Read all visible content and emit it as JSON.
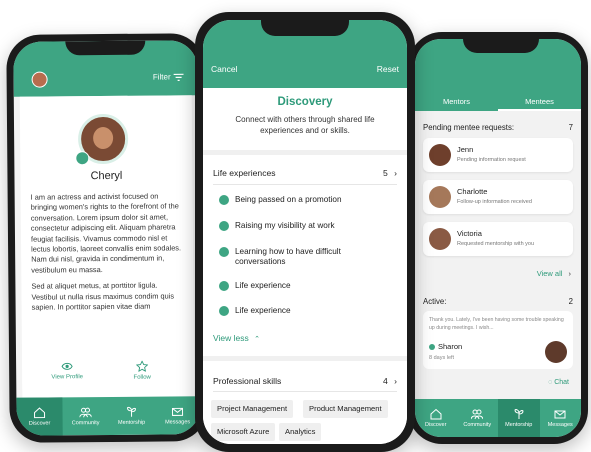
{
  "left_phone": {
    "filter_label": "Filter",
    "profile_name": "Cheryl",
    "bio_p1": "I am an actress and activist focused on bringing women's rights to the forefront of the conversation. Lorem ipsum dolor sit amet, consectetur adipiscing elit. Aliquam pharetra feugiat facilisis. Vivamus commodo nisl et lectus lobortis, laoreet convallis enim sodales. Nam dui nisl, gravida in condimentum in, vestibulum eu massa.",
    "bio_p2": "Sed at aliquet metus, at porttitor ligula. Vestibul ut nulla risus maximus condim quis sapien. In porttitor sapien vitae diam",
    "view_profile_label": "View Profile",
    "follow_label": "Follow",
    "tabs": [
      "Discover",
      "Community",
      "Mentorship",
      "Messages"
    ]
  },
  "center_phone": {
    "cancel_label": "Cancel",
    "reset_label": "Reset",
    "title": "Discovery",
    "subtitle": "Connect with others through shared life experiences and or skills.",
    "life_section_label": "Life experiences",
    "life_count": "5",
    "experiences": [
      "Being passed on a promotion",
      "Raising my visibility at work",
      "Learning how to have difficult conversations",
      "Life experience",
      "Life experience"
    ],
    "view_less_label": "View less",
    "skills_section_label": "Professional skills",
    "skills_count": "4",
    "skills": [
      "Project Management",
      "Product Management",
      "Microsoft Azure",
      "Analytics"
    ]
  },
  "right_phone": {
    "tabs_top": [
      "Mentors",
      "Mentees"
    ],
    "pending_label": "Pending mentee requests:",
    "pending_count": "7",
    "requests": [
      {
        "name": "Jenn",
        "status": "Pending information request"
      },
      {
        "name": "Charlotte",
        "status": "Follow-up information received"
      },
      {
        "name": "Victoria",
        "status": "Requested mentorship with you"
      }
    ],
    "view_all_label": "View all",
    "active_label": "Active:",
    "active_count": "2",
    "active_message": "Thank you. Lately, I've been having some trouble speaking up during meetings. I wish...",
    "active_name": "Sharon",
    "active_days": "8 days left",
    "chat_label": "Chat",
    "tabs": [
      "Discover",
      "Community",
      "Mentorship",
      "Messages"
    ]
  },
  "colors": {
    "accent": "#3ea583",
    "accent_dark": "#2b8a6b",
    "title_green": "#2e9a7a"
  }
}
